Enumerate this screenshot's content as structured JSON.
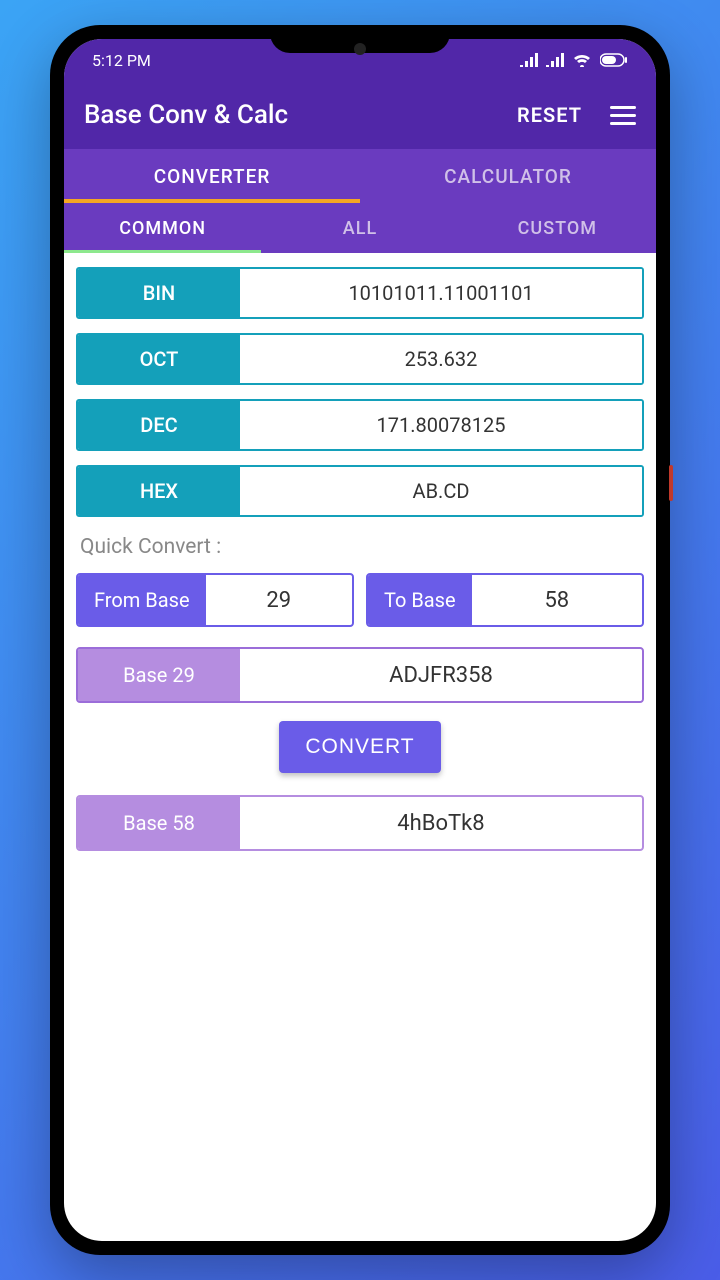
{
  "status": {
    "time": "5:12 PM"
  },
  "appbar": {
    "title": "Base Conv & Calc",
    "reset": "RESET"
  },
  "tabs": {
    "primary": [
      "CONVERTER",
      "CALCULATOR"
    ],
    "secondary": [
      "COMMON",
      "ALL",
      "CUSTOM"
    ]
  },
  "conversions": [
    {
      "label": "BIN",
      "value": "10101011.11001101"
    },
    {
      "label": "OCT",
      "value": "253.632"
    },
    {
      "label": "DEC",
      "value": "171.80078125"
    },
    {
      "label": "HEX",
      "value": "AB.CD"
    }
  ],
  "quick": {
    "title": "Quick Convert :",
    "from_label": "From Base",
    "from_value": "29",
    "to_label": "To Base",
    "to_value": "58",
    "input_label": "Base 29",
    "input_value": "ADJFR358",
    "convert_btn": "CONVERT",
    "output_label": "Base 58",
    "output_value": "4hBoTk8"
  }
}
